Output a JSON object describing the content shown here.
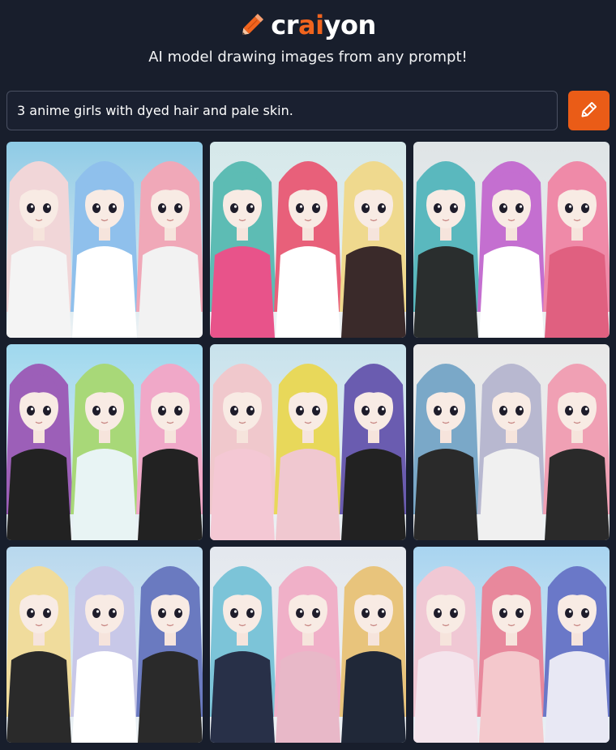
{
  "header": {
    "logo_prefix": "cr",
    "logo_accent": "ai",
    "logo_suffix": "yon",
    "tagline": "AI model drawing images from any prompt!"
  },
  "prompt": {
    "value": "3 anime girls with dyed hair and pale skin.",
    "button_icon": "pencil-icon"
  },
  "colors": {
    "background": "#181e2c",
    "accent": "#ea5c17"
  },
  "results": [
    {
      "hair": [
        "#f1d6d8",
        "#8fc0ec",
        "#f0a8b8"
      ],
      "sky": "#8fcbe6",
      "outfit": [
        "#f4f4f4",
        "#ffffff",
        "#f2f2f2"
      ]
    },
    {
      "hair": [
        "#5dbcb4",
        "#e8607a",
        "#efd98e"
      ],
      "sky": "#d5e8ea",
      "outfit": [
        "#e8538a",
        "#ffffff",
        "#3a2a2a"
      ]
    },
    {
      "hair": [
        "#5ab8be",
        "#c46fd0",
        "#ef8aa8"
      ],
      "sky": "#dfe4e6",
      "outfit": [
        "#2a2e2e",
        "#ffffff",
        "#e06080"
      ]
    },
    {
      "hair": [
        "#9c5fb8",
        "#a8d878",
        "#f0a8c8"
      ],
      "sky": "#9fd8ee",
      "outfit": [
        "#222222",
        "#e8f4f4",
        "#222222"
      ]
    },
    {
      "hair": [
        "#f0c8cc",
        "#e8d85a",
        "#6a5cb0"
      ],
      "sky": "#c8e2ec",
      "outfit": [
        "#f4c8d4",
        "#f0c8d0",
        "#222222"
      ]
    },
    {
      "hair": [
        "#7aa8c8",
        "#b8b8d0",
        "#f0a0b4"
      ],
      "sky": "#e8e8e8",
      "outfit": [
        "#2a2a2a",
        "#f0f0f0",
        "#2a2a2a"
      ]
    },
    {
      "hair": [
        "#f0dc9c",
        "#c8c8e8",
        "#6a7ac0"
      ],
      "sky": "#b8d8ee",
      "outfit": [
        "#2a2a2a",
        "#ffffff",
        "#2a2a2a"
      ]
    },
    {
      "hair": [
        "#7cc4d8",
        "#f0b0c8",
        "#e8c47c"
      ],
      "sky": "#e4e8ee",
      "outfit": [
        "#283048",
        "#e8b8c8",
        "#202838"
      ]
    },
    {
      "hair": [
        "#f0c8d4",
        "#e8889c",
        "#6a78c8"
      ],
      "sky": "#a8d4f0",
      "outfit": [
        "#f4e4ec",
        "#f4c8cc",
        "#e8e8f4"
      ]
    }
  ]
}
